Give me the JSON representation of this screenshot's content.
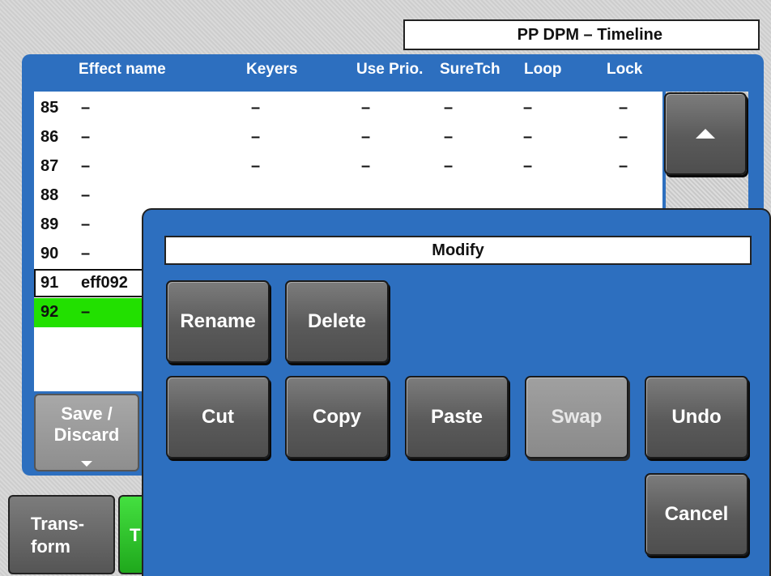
{
  "title": "PP DPM – Timeline",
  "columns": {
    "effect_name": "Effect name",
    "keyers": "Keyers",
    "use_prio": "Use Prio.",
    "suretch": "SureTch",
    "loop": "Loop",
    "lock": "Lock"
  },
  "rows": [
    {
      "num": "85",
      "name": "–",
      "keyers": "–",
      "use_prio": "–",
      "suretch": "–",
      "loop": "–",
      "lock": "–"
    },
    {
      "num": "86",
      "name": "–",
      "keyers": "–",
      "use_prio": "–",
      "suretch": "–",
      "loop": "–",
      "lock": "–"
    },
    {
      "num": "87",
      "name": "–",
      "keyers": "–",
      "use_prio": "–",
      "suretch": "–",
      "loop": "–",
      "lock": "–"
    },
    {
      "num": "88",
      "name": "–"
    },
    {
      "num": "89",
      "name": "–"
    },
    {
      "num": "90",
      "name": "–"
    },
    {
      "num": "91",
      "name": "eff092"
    },
    {
      "num": "92",
      "name": "–"
    }
  ],
  "save_discard": {
    "line1": "Save /",
    "line2": "Discard"
  },
  "bottom_tabs": {
    "transform_line1": "Trans-",
    "transform_line2": "form",
    "next_tab_partial": "T"
  },
  "modal": {
    "title": "Modify",
    "rename": "Rename",
    "delete": "Delete",
    "cut": "Cut",
    "copy": "Copy",
    "paste": "Paste",
    "swap": "Swap",
    "undo": "Undo",
    "cancel": "Cancel"
  },
  "colors": {
    "panel_blue": "#2d6fbf",
    "active_row": "#22e000"
  }
}
